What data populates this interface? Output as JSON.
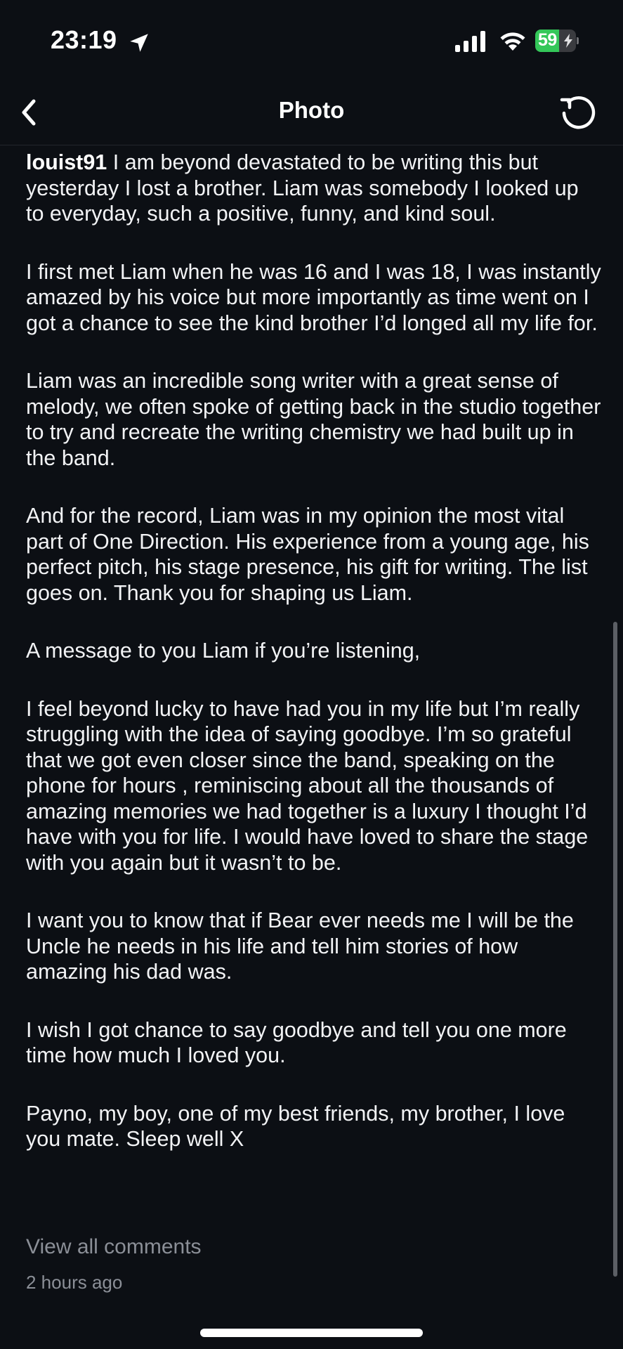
{
  "status_bar": {
    "time": "23:19",
    "battery_level": "59",
    "battery_percent": 59,
    "battery_color": "#34c759",
    "icons": [
      "location-arrow-icon",
      "cellular-signal-icon",
      "wifi-icon",
      "battery-charging-icon"
    ]
  },
  "nav": {
    "title": "Photo",
    "back_icon": "chevron-left-icon",
    "refresh_icon": "refresh-icon"
  },
  "caption": {
    "username": "louist91",
    "paragraphs": [
      "I am beyond devastated to be writing this but yesterday I lost a brother. Liam was somebody I looked up to everyday, such a positive, funny, and kind soul.",
      "I first met Liam when he was 16 and I was 18, I was instantly amazed by his voice but more importantly as time went on I got a chance to see the kind brother I’d longed all my life for.",
      "Liam was an incredible song writer with a great sense of melody, we often spoke of getting back in the studio together to try and recreate the writing chemistry we had built up in the band.",
      "And for the record, Liam was in my opinion the most vital part of One Direction. His experience from a young age, his perfect pitch, his stage presence, his gift for writing. The list goes on. Thank you for shaping us Liam.",
      "A message to you Liam if you’re listening,",
      "I feel beyond lucky to have had you in my life but I’m really struggling with the idea of saying goodbye. I’m so grateful that we got even closer since the band, speaking on the phone for hours , reminiscing about all the thousands of amazing memories we had together is a luxury I thought I’d have with you for life. I would have loved to share the stage with you again but it wasn’t to be.",
      "I want you to know that if Bear ever needs me I will be the Uncle he needs in his life and tell him stories of how amazing his dad was.",
      "I wish I got chance to say goodbye and tell you one more time how much I loved you.",
      "Payno, my boy, one of my best friends, my brother, I love you mate. Sleep well X"
    ]
  },
  "footer": {
    "view_comments": "View all comments",
    "timestamp": "2 hours ago"
  }
}
